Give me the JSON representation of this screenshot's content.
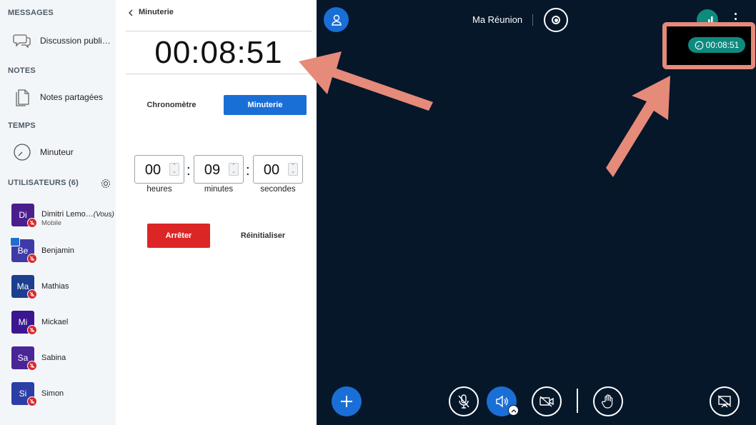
{
  "sidebar": {
    "messages_title": "MESSAGES",
    "public_chat_label": "Discussion publi…",
    "notes_title": "NOTES",
    "shared_notes_label": "Notes partagées",
    "time_title": "TEMPS",
    "timer_label": "Minuteur",
    "users_title": "UTILISATEURS (6)",
    "users": [
      {
        "initials": "Di",
        "name": "Dimitri Lemo…",
        "you": "(Vous)",
        "sub": "Mobile",
        "color": "#4a1f8c"
      },
      {
        "initials": "Be",
        "name": "Benjamin",
        "color": "#3e3aa8"
      },
      {
        "initials": "Ma",
        "name": "Mathias",
        "color": "#1c3f8f"
      },
      {
        "initials": "Mi",
        "name": "Mickael",
        "color": "#3a1790"
      },
      {
        "initials": "Sa",
        "name": "Sabina",
        "color": "#4a2596"
      },
      {
        "initials": "Si",
        "name": "Simon",
        "color": "#2b3ea6"
      }
    ]
  },
  "panel": {
    "title": "Minuterie",
    "time_display": "00:08:51",
    "stopwatch_label": "Chronomètre",
    "timer_label": "Minuterie",
    "hours_value": "00",
    "minutes_value": "09",
    "seconds_value": "00",
    "hours_label": "heures",
    "minutes_label": "minutes",
    "seconds_label": "secondes",
    "stop_label": "Arrêter",
    "reset_label": "Réinitialiser"
  },
  "main": {
    "meeting_title": "Ma Réunion",
    "timer_pill": "00:08:51"
  },
  "colors": {
    "accent": "#1a6fd6",
    "danger": "#dc2626",
    "teal": "#0f8a7e",
    "annotation": "#e68a7a",
    "background": "#06172a"
  }
}
